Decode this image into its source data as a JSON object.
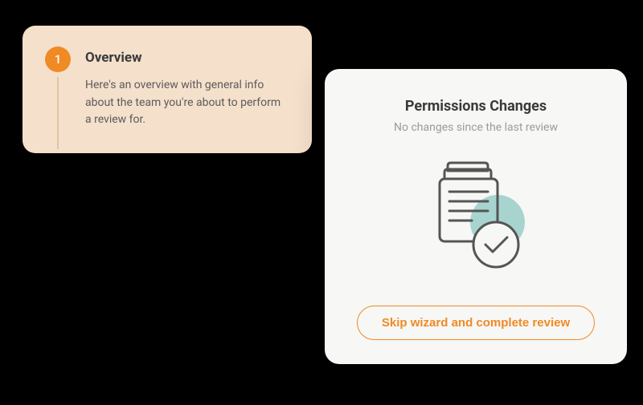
{
  "overview": {
    "step_number": "1",
    "title": "Overview",
    "description": "Here's an overview with general info about the team you're about to perform a review for."
  },
  "permissions": {
    "title": "Permissions Changes",
    "subtitle": "No changes since the last review",
    "skip_button_label": "Skip wizard and complete review"
  },
  "colors": {
    "accent": "#f08a24",
    "overview_bg": "#f5e0cc",
    "card_bg": "#f7f7f5",
    "illustration_accent": "#a8d4d0"
  }
}
